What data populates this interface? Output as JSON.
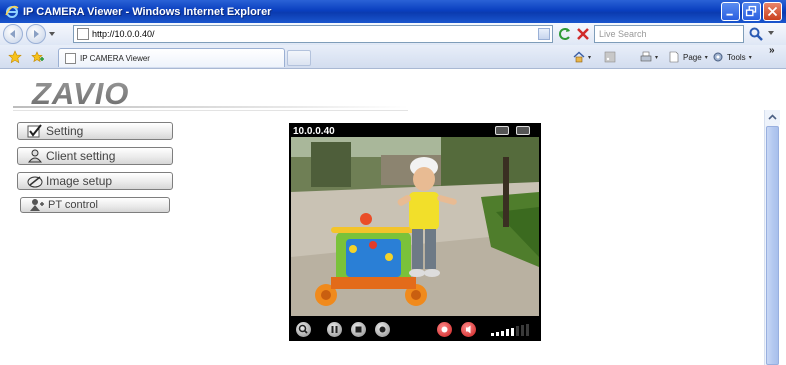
{
  "window": {
    "title": "IP CAMERA Viewer - Windows Internet Explorer"
  },
  "address_bar": {
    "url": "http://10.0.0.40/",
    "search_placeholder": "Live Search"
  },
  "tab_bar": {
    "active_tab_label": "IP CAMERA Viewer",
    "page_label": "Page",
    "tools_label": "Tools",
    "overflow_label": "»"
  },
  "page": {
    "logo_text": "ZAVIO",
    "menu": {
      "setting": "Setting",
      "client_setting": "Client setting",
      "image_setup": "Image setup",
      "pt_control": "PT control"
    },
    "video": {
      "camera_ip": "10.0.0.40"
    }
  },
  "colors": {
    "titlebar": "#0b3bb0",
    "accent_blue": "#2a5fe0",
    "close_red": "#c9411f",
    "scroll_thumb": "#b4c9f0"
  },
  "icons": {
    "nav": [
      "back-icon",
      "forward-icon"
    ],
    "menu": [
      "checkmark-icon",
      "user-icon",
      "image-icon",
      "pt-control-icon"
    ],
    "video_controls": [
      "zoom-icon",
      "pause-icon",
      "stop-icon",
      "record-icon",
      "snapshot-icon",
      "audio-icon"
    ]
  }
}
